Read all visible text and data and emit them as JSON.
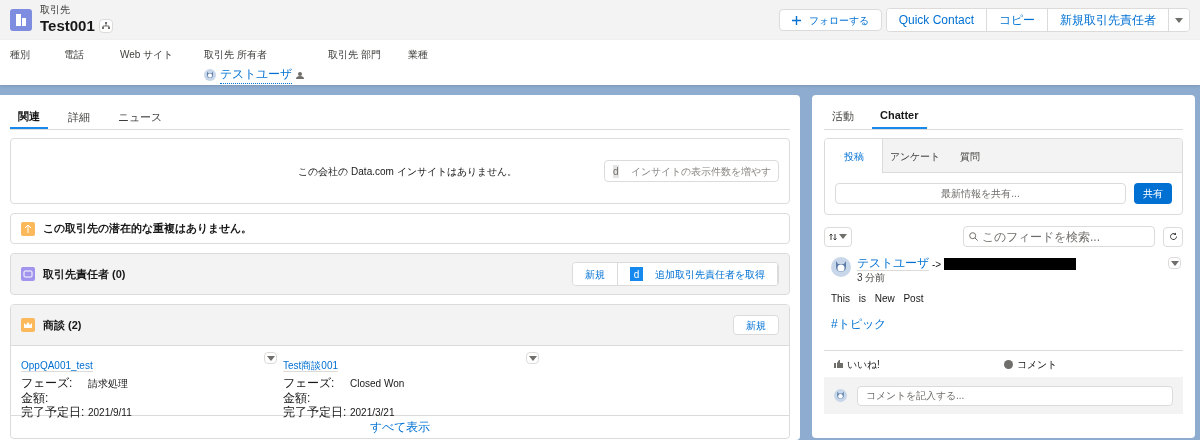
{
  "header": {
    "object_type": "取引先",
    "title": "Test001",
    "actions": [
      {
        "label": "フォローする",
        "kind": "follow"
      },
      {
        "label": "Quick Contact",
        "kind": "button"
      },
      {
        "label": "コピー",
        "kind": "button"
      },
      {
        "label": "新規取引先責任者",
        "kind": "button"
      },
      {
        "kind": "menu"
      }
    ],
    "fields": [
      {
        "label": "種別"
      },
      {
        "label": "電話"
      },
      {
        "label": "Web サイト"
      },
      {
        "label": "取引先 所有者",
        "value": "テストユーザ"
      },
      {
        "label": "取引先 部門"
      },
      {
        "label": "業種"
      }
    ]
  },
  "tabs": [
    {
      "label": "関連",
      "selected": true
    },
    {
      "label": "詳細",
      "selected": false
    },
    {
      "label": "ニュース",
      "selected": false
    }
  ],
  "insight": {
    "message": "この会社の Data.com インサイトはありません。",
    "button": {
      "logo": "d",
      "label": "インサイトの表示件数を増やす",
      "disabled": true
    }
  },
  "duplicates": {
    "message": "この取引先の潜在的な重複はありません。"
  },
  "contacts": {
    "title": "取引先責任者 (0)",
    "buttons": [
      {
        "label": "新規"
      },
      {
        "label": "追加取引先責任者を取得",
        "logo": "d"
      }
    ]
  },
  "opportunities": {
    "title": "商談 (2)",
    "buttons": [
      {
        "label": "新規"
      }
    ],
    "records": [
      {
        "name": "OppQA001_test",
        "fields": [
          {
            "label": "フェーズ:",
            "value": "請求処理"
          },
          {
            "label": "金額:"
          },
          {
            "label": "完了予定日:",
            "value": "2021/9/11"
          }
        ]
      },
      {
        "name": "Test商談001",
        "fields": [
          {
            "label": "フェーズ:",
            "value": "Closed Won"
          },
          {
            "label": "金額:"
          },
          {
            "label": "完了予定日:",
            "value": "2021/3/21"
          }
        ]
      }
    ],
    "view_all": "すべて表示"
  },
  "side_tabs": [
    {
      "label": "活動",
      "selected": false
    },
    {
      "label": "Chatter",
      "selected": true
    }
  ],
  "publisher": {
    "tabs": [
      {
        "label": "投稿",
        "selected": true
      },
      {
        "label": "アンケート",
        "selected": false
      },
      {
        "label": "質問",
        "selected": false
      }
    ],
    "placeholder": "最新情報を共有...",
    "share": "共有"
  },
  "feed": {
    "search_placeholder": "このフィードを検索...",
    "post": {
      "author": "テストユーザ",
      "arrow": "->",
      "time": "3 分前",
      "body": "This is New Post",
      "topic": "#トピック",
      "like": "いいね!",
      "comment": "コメント",
      "comment_placeholder": "コメントを記入する..."
    }
  }
}
